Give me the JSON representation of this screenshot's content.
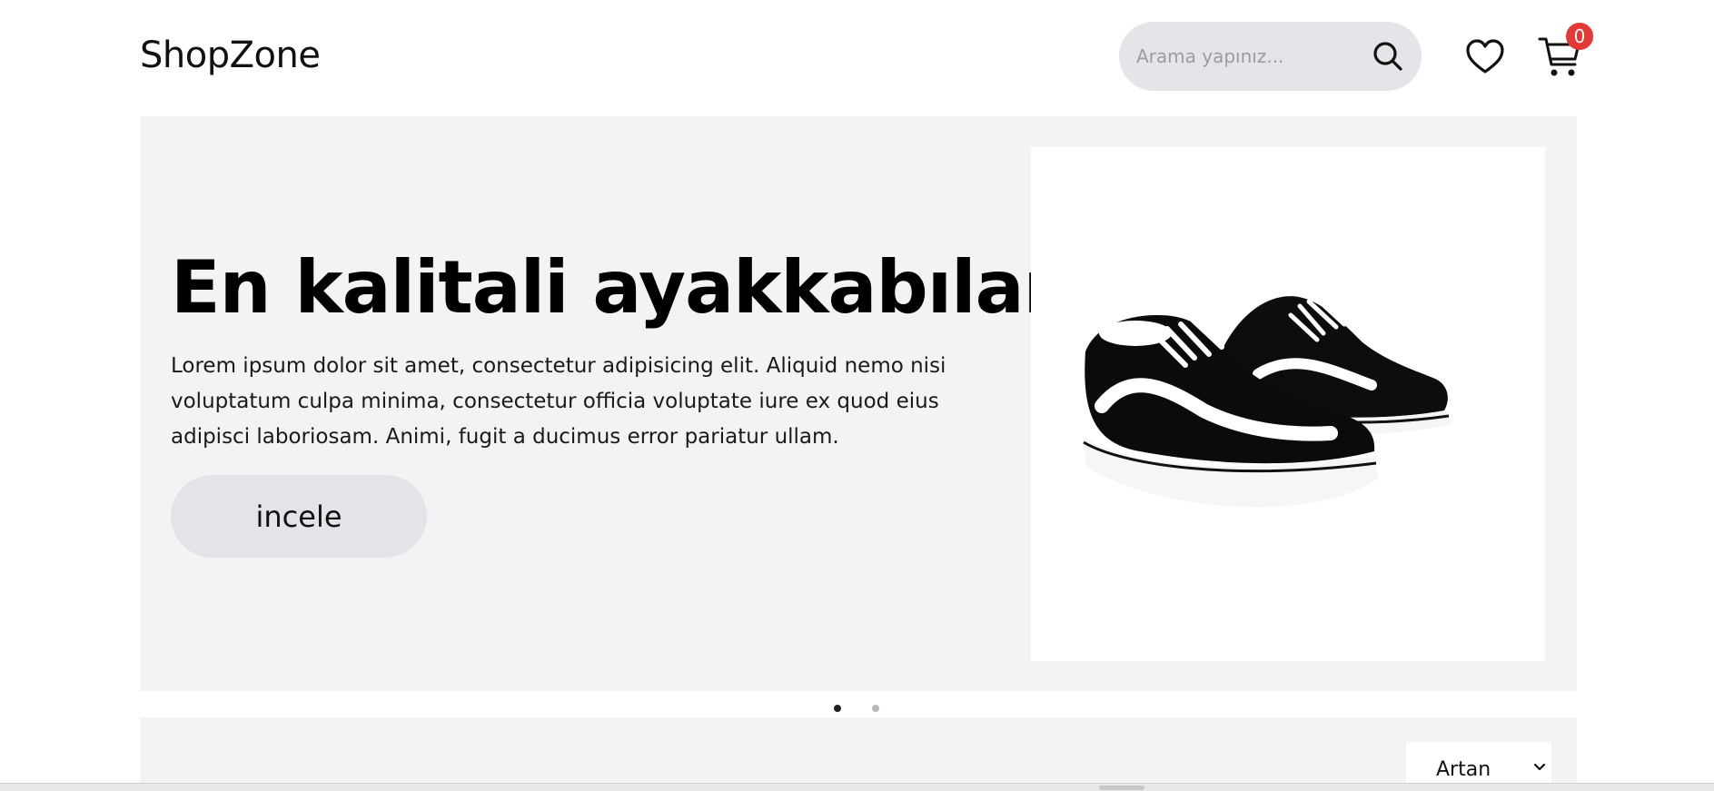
{
  "header": {
    "logo": "ShopZone",
    "search_placeholder": "Arama yapınız...",
    "search_value": "",
    "cart_count": "0"
  },
  "hero": {
    "title": "En kalitali ayakkabılar",
    "text": "Lorem ipsum dolor sit amet, consectetur adipisicing elit. Aliquid nemo nisi voluptatum culpa minima, consectetur officia voluptate iure ex quod eius adipisci laboriosam. Animi, fugit a ducimus error pariatur ullam.",
    "button_label": "incele",
    "image": "black-white-sneakers",
    "slides_total": 2,
    "active_slide": 1
  },
  "sort": {
    "selected": "Artan"
  },
  "colors": {
    "accent_badge": "#e53935",
    "hero_bg": "#f2f3f5",
    "pill_bg": "#e4e5e9"
  },
  "icons": {
    "search": "search-icon",
    "wishlist": "heart-icon",
    "cart": "cart-icon",
    "sort_arrow": "chevron-down-icon"
  }
}
